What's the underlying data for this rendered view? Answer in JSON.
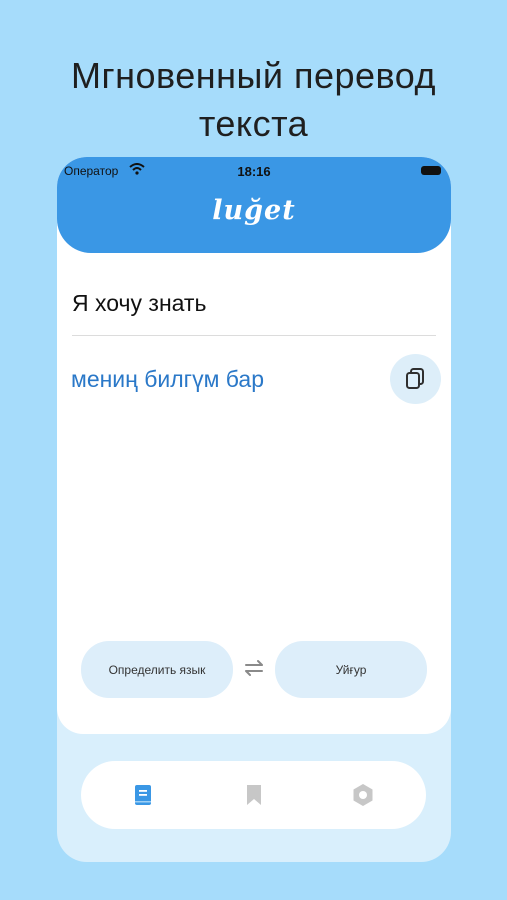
{
  "headline": {
    "line1": "Мгновенный перевод",
    "line2": "текста"
  },
  "status_bar": {
    "carrier": "Оператор",
    "time": "18:16"
  },
  "app": {
    "logo": "luğet"
  },
  "translator": {
    "source_text": "Я хочу знать",
    "translated_text": "мениң билгүм бар"
  },
  "languages": {
    "source_label": "Определить язык",
    "target_label": "Уйғур"
  },
  "tabs": [
    {
      "icon": "book-icon",
      "active": true
    },
    {
      "icon": "bookmark-icon",
      "active": false
    },
    {
      "icon": "settings-hexagon-icon",
      "active": false
    }
  ],
  "colors": {
    "background": "#a6dcfb",
    "header": "#3a97e5",
    "translation_text": "#2a78c8",
    "active_tab": "#3a97e5",
    "inactive_tab": "#c7c7c7"
  }
}
